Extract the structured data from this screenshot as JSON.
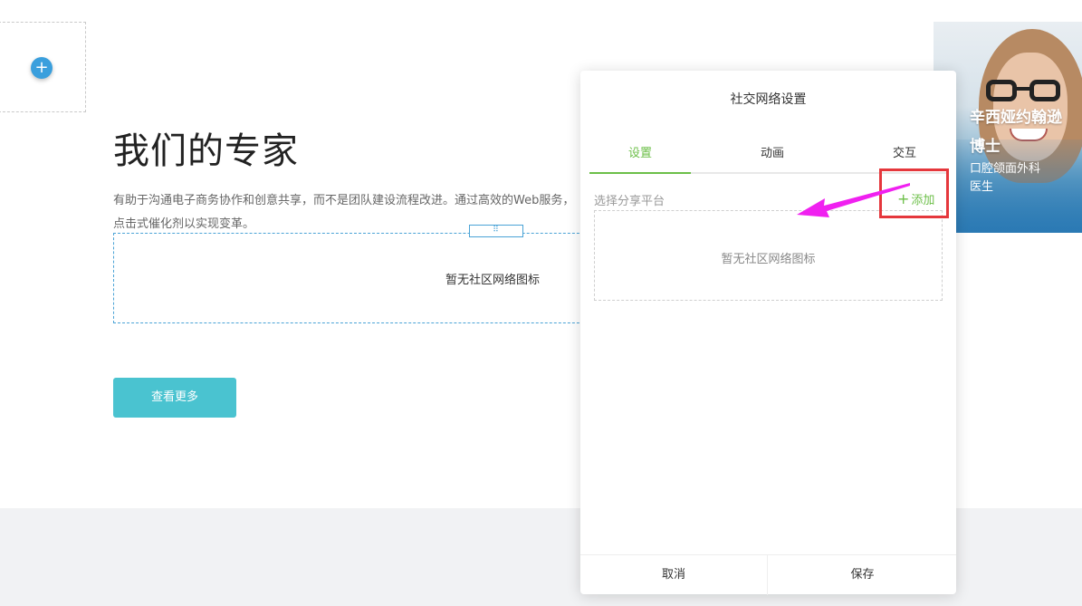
{
  "page": {
    "add_block_icon": "plus-icon",
    "title": "我们的专家",
    "description": "有助于沟通电子商务协作和创意共享，而不是团队建设流程改进。通过高效的Web服务，点击式催化剂以实现变革。",
    "social_box_empty": "暂无社区网络图标",
    "handle_glyph": "⠿",
    "more_button": "查看更多"
  },
  "expert_card": {
    "name": "辛西娅约翰逊博士",
    "role": "口腔颌面外科医生"
  },
  "dialog": {
    "title": "社交网络设置",
    "tabs": [
      {
        "label": "设置",
        "active": true
      },
      {
        "label": "动画",
        "active": false
      },
      {
        "label": "交互",
        "active": false
      }
    ],
    "platform_label": "选择分享平台",
    "add_icon": "plus-icon",
    "add_label": "添加",
    "empty_text": "暂无社区网络图标",
    "cancel_label": "取消",
    "save_label": "保存"
  },
  "annotation": {
    "highlight_color": "#e5373c",
    "arrow_color": "#f020f0"
  },
  "colors": {
    "accent_green": "#6cbf48",
    "teal_button": "#4ac3d0",
    "blue_plus": "#3a9fdd",
    "selection_blue": "#4aa3d6"
  }
}
